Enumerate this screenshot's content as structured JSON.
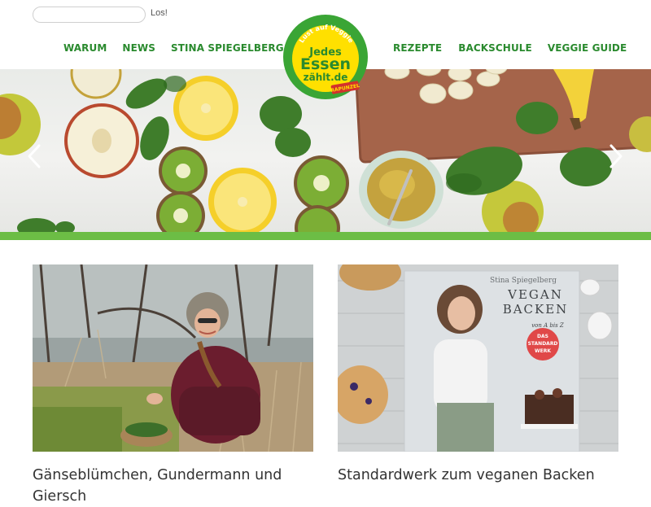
{
  "search": {
    "placeholder": "",
    "value": "",
    "button_label": "Los!"
  },
  "nav_left": [
    "WARUM",
    "NEWS",
    "STINA SPIEGELBERG"
  ],
  "nav_right": [
    "REZEPTE",
    "BACKSCHULE",
    "VEGGIE GUIDE"
  ],
  "logo": {
    "arc_text": "Lust auf Veggie",
    "line1": "Jedes",
    "line2": "Essen",
    "line3": "zählt.de",
    "badge": "RAPUNZEL"
  },
  "book": {
    "author": "Stina Spiegelberg",
    "title_line1": "VEGAN",
    "title_line2": "BACKEN",
    "subtitle": "von A bis Z",
    "badge_line1": "DAS",
    "badge_line2": "STANDARD",
    "badge_line3": "WERK"
  },
  "articles": [
    {
      "title": "Gänseblümchen, Gundermann und Giersch"
    },
    {
      "title": "Standardwerk zum veganen Backen"
    }
  ],
  "colors": {
    "nav_green": "#2a8a2e",
    "accent_bar": "#6cbd45",
    "logo_yellow": "#ffe000",
    "logo_green": "#3aa535"
  }
}
